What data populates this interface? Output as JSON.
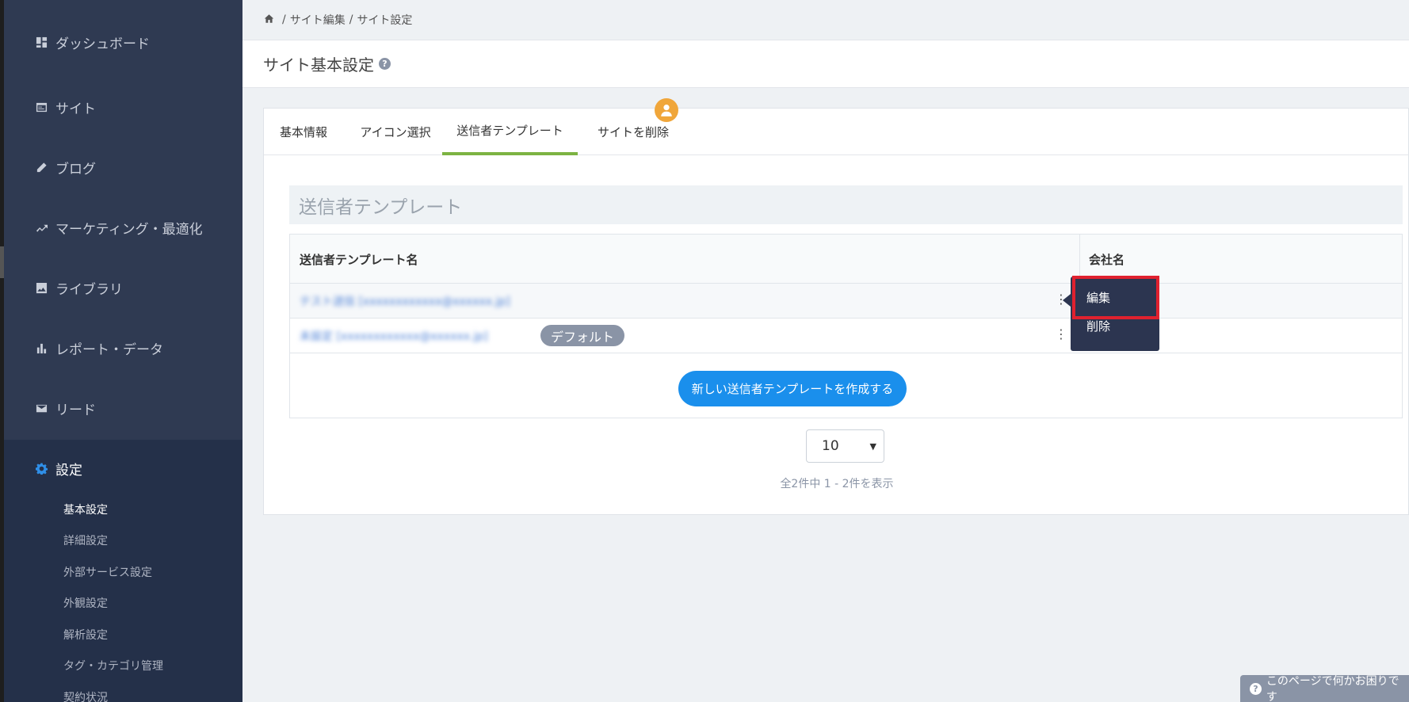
{
  "sidebar": {
    "items": [
      {
        "label": "ダッシュボード",
        "icon": "dashboard-icon"
      },
      {
        "label": "サイト",
        "icon": "site-icon"
      },
      {
        "label": "ブログ",
        "icon": "pencil-icon"
      },
      {
        "label": "マーケティング・最適化",
        "icon": "trending-icon"
      },
      {
        "label": "ライブラリ",
        "icon": "image-icon"
      },
      {
        "label": "レポート・データ",
        "icon": "bar-chart-icon"
      },
      {
        "label": "リード",
        "icon": "mail-icon"
      },
      {
        "label": "設定",
        "icon": "gear-icon"
      }
    ],
    "subitems": [
      {
        "label": "基本設定"
      },
      {
        "label": "詳細設定"
      },
      {
        "label": "外部サービス設定"
      },
      {
        "label": "外観設定"
      },
      {
        "label": "解析設定"
      },
      {
        "label": "タグ・カテゴリ管理"
      },
      {
        "label": "契約状況"
      }
    ]
  },
  "breadcrumb": {
    "items": [
      "サイト編集",
      "サイト設定"
    ],
    "separator": "/"
  },
  "header": {
    "title": "サイト基本設定",
    "help": "?"
  },
  "tabs": [
    {
      "label": "基本情報"
    },
    {
      "label": "アイコン選択"
    },
    {
      "label": "送信者テンプレート"
    },
    {
      "label": "サイトを削除"
    }
  ],
  "section": {
    "title": "送信者テンプレート"
  },
  "table": {
    "headers": [
      "送信者テンプレート名",
      "会社名"
    ],
    "rows": [
      {
        "name": "テスト送信 [xxxxxxxxxxxx@xxxxxx.jp]",
        "default": ""
      },
      {
        "name": "未設定 [xxxxxxxxxxxx@xxxxxx.jp]",
        "default": "デフォルト"
      }
    ],
    "kebab": "⋮"
  },
  "create_button": "新しい送信者テンプレートを作成する",
  "pager": {
    "page_size": "10",
    "info": "全2件中 1 - 2件を表示"
  },
  "context_menu": {
    "edit": "編集",
    "delete": "削除"
  },
  "help_float": {
    "label": "このページで何かお困りです"
  },
  "colors": {
    "sidebar": "#2f3a52",
    "accent_tab": "#7cb342",
    "primary_button": "#1a8fec",
    "highlight": "#e0212f"
  }
}
